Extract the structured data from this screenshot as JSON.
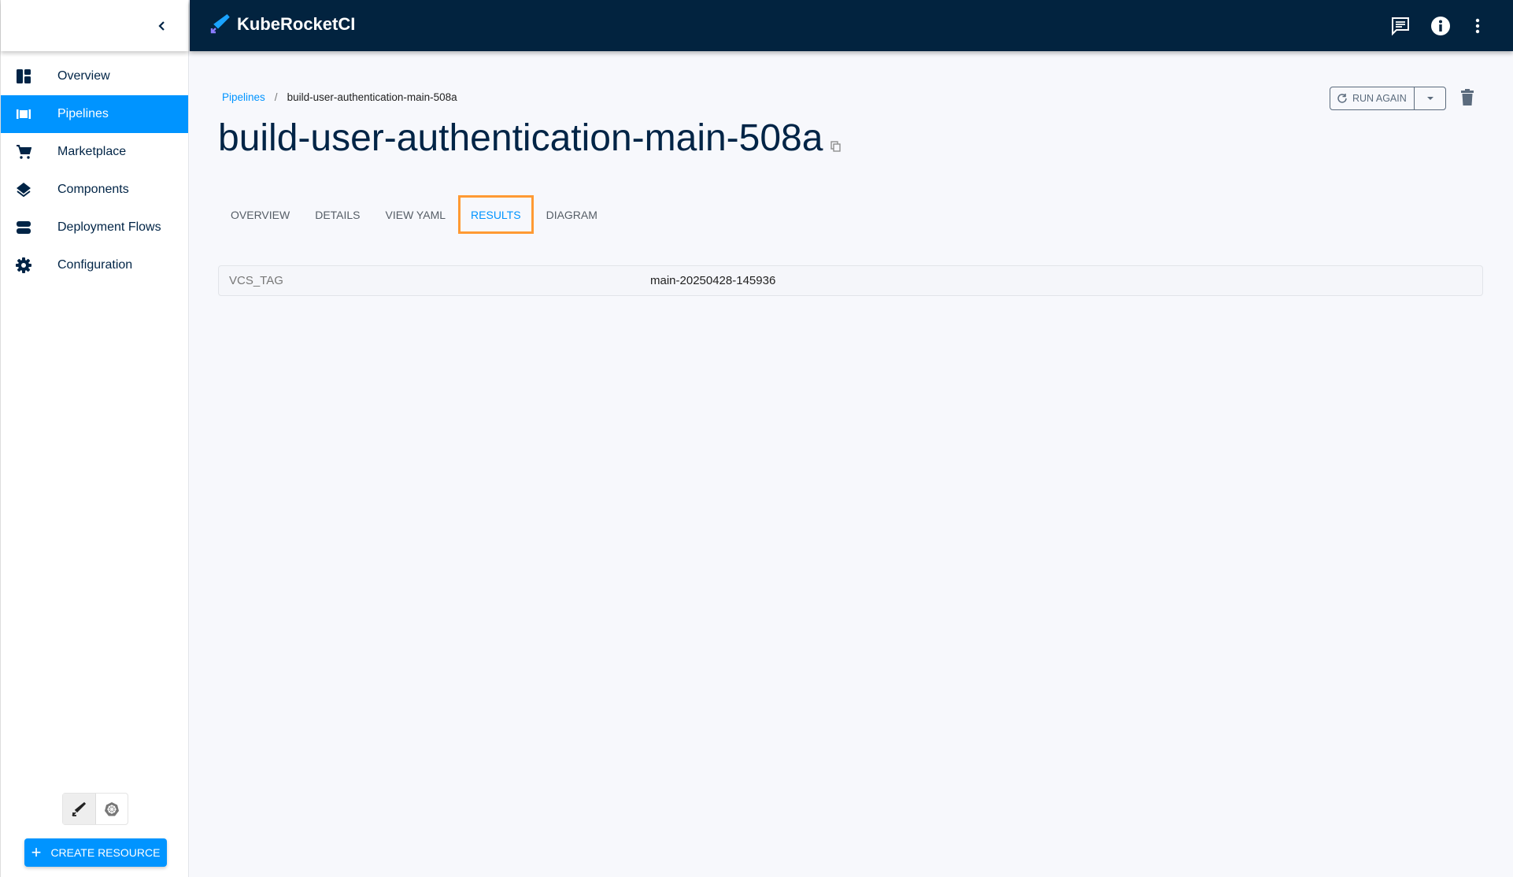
{
  "app": {
    "title": "KubeRocketCI"
  },
  "sidebar": {
    "items": [
      {
        "label": "Overview",
        "icon": "dashboard-icon"
      },
      {
        "label": "Pipelines",
        "icon": "pipelines-icon",
        "active": true
      },
      {
        "label": "Marketplace",
        "icon": "cart-icon"
      },
      {
        "label": "Components",
        "icon": "layers-icon"
      },
      {
        "label": "Deployment Flows",
        "icon": "storage-icon"
      },
      {
        "label": "Configuration",
        "icon": "gear-icon"
      }
    ],
    "create_label": "CREATE RESOURCE"
  },
  "breadcrumb": {
    "parent": "Pipelines",
    "separator": "/",
    "current": "build-user-authentication-main-508a"
  },
  "page": {
    "title": "build-user-authentication-main-508a",
    "run_again_label": "RUN AGAIN"
  },
  "tabs": [
    {
      "label": "OVERVIEW"
    },
    {
      "label": "DETAILS"
    },
    {
      "label": "VIEW YAML"
    },
    {
      "label": "RESULTS",
      "active": true
    },
    {
      "label": "DIAGRAM"
    }
  ],
  "results": [
    {
      "key": "VCS_TAG",
      "value": "main-20250428-145936"
    }
  ],
  "colors": {
    "accent": "#0094ff",
    "header": "#02233f",
    "highlight": "#ff9a33"
  }
}
